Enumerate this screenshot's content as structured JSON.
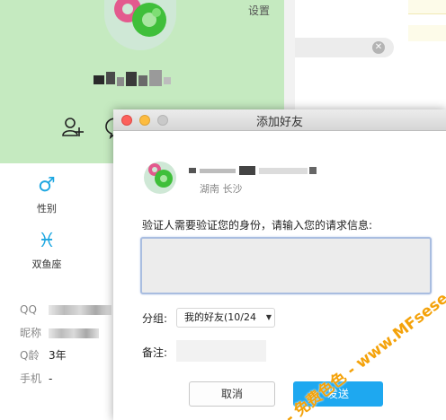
{
  "profile": {
    "settings_label": "设置",
    "attributes": {
      "gender_label": "性别",
      "zodiac_label": "双鱼座"
    },
    "info": [
      {
        "key": "QQ",
        "value": ""
      },
      {
        "key": "昵称",
        "value": ""
      },
      {
        "key": "Q龄",
        "value": "3年"
      },
      {
        "key": "手机",
        "value": "-"
      }
    ]
  },
  "dialog": {
    "title": "添加好友",
    "target_location": "湖南 长沙",
    "verify_prompt": "验证人需要验证您的身份，请输入您的请求信息:",
    "request_message": "",
    "group_label": "分组:",
    "group_value": "我的好友(10/24",
    "remark_label": "备注:",
    "remark_value": "",
    "cancel_label": "取消",
    "send_label": "发送"
  },
  "watermark": {
    "text": "- 免费色色 - www.MFsese.com"
  },
  "colors": {
    "profile_header_bg": "#c5eac0",
    "accent_blue": "#1ea8f0",
    "watermark": "#f4a20a"
  }
}
